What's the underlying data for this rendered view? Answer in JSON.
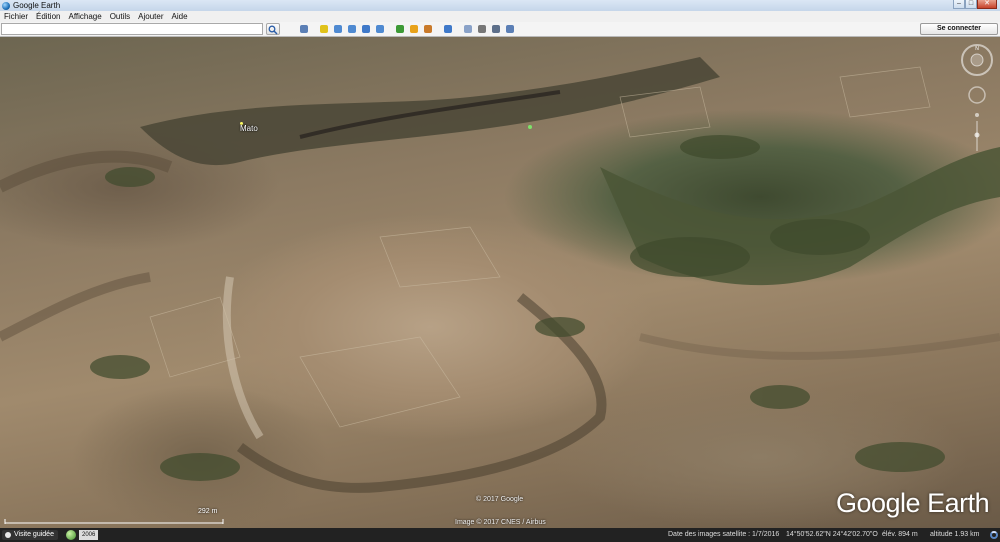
{
  "window": {
    "title": "Google Earth"
  },
  "menu": [
    "Fichier",
    "Édition",
    "Affichage",
    "Outils",
    "Ajouter",
    "Aide"
  ],
  "search": {
    "value": "",
    "placeholder": ""
  },
  "toolbar": {
    "connect_label": "Se connecter",
    "buttons": [
      {
        "name": "sidebar-toggle-icon",
        "color": "#5b7fb5"
      },
      {
        "name": "placemark-icon",
        "color": "#e0c21a"
      },
      {
        "name": "polygon-icon",
        "color": "#4f8ad1"
      },
      {
        "name": "path-icon",
        "color": "#4f8ad1"
      },
      {
        "name": "image-overlay-icon",
        "color": "#3f79c9"
      },
      {
        "name": "record-tour-icon",
        "color": "#4f8ad1"
      },
      {
        "name": "historical-imagery-icon",
        "color": "#3d9a36"
      },
      {
        "name": "sun-icon",
        "color": "#e8a21a"
      },
      {
        "name": "planets-icon",
        "color": "#c97a2a"
      },
      {
        "name": "ruler-icon",
        "color": "#3f79c9"
      },
      {
        "name": "email-icon",
        "color": "#8aa2c8"
      },
      {
        "name": "print-icon",
        "color": "#777777"
      },
      {
        "name": "save-image-icon",
        "color": "#5d6f8a"
      },
      {
        "name": "view-in-maps-icon",
        "color": "#5b7fb5"
      }
    ]
  },
  "map": {
    "place_label": "Mato",
    "copyright_google": "© 2017 Google",
    "copyright_image": "Image © 2017 CNES / Airbus",
    "logo": "Google Earth",
    "scale_label": "292 m"
  },
  "status": {
    "tour_label": "Visite guidée",
    "year": "2006",
    "imagery_date": "Date des images satellite : 1/7/2016",
    "coordinates": "14°50'52.62\"N   24°42'02.70\"O",
    "elevation": "élév.  894 m",
    "altitude": "altitude  1.93 km"
  }
}
